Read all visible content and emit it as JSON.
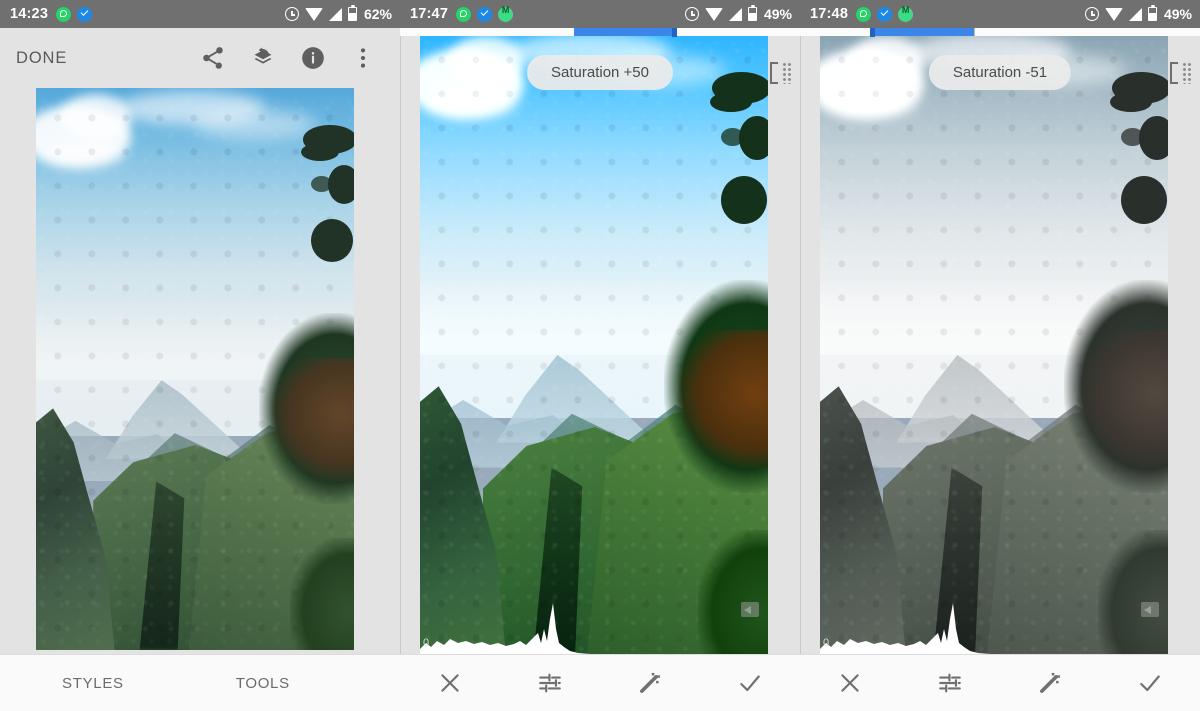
{
  "app": {
    "name": "Snapseed",
    "screenshot_layout": "three-panel"
  },
  "panels": [
    {
      "id": "editor-home",
      "status_bar": {
        "time": "14:23",
        "battery_percent": "62%",
        "left_icons": [
          "whatsapp-icon",
          "blue-check-icon"
        ],
        "right_icons": [
          "alarm-icon",
          "wifi-icon",
          "signal-icon",
          "battery-icon"
        ]
      },
      "toolbar": {
        "done_label": "DONE",
        "icons": [
          "share-icon",
          "revert-stack-icon",
          "info-icon",
          "overflow-menu-icon"
        ]
      },
      "bottom_nav": {
        "styles_label": "STYLES",
        "tools_label": "TOOLS"
      },
      "photo": {
        "alt": "Mountain valley landscape with blue sky, clouds and trees",
        "variant": "original"
      }
    },
    {
      "id": "saturation-increase",
      "status_bar": {
        "time": "17:47",
        "battery_percent": "49%",
        "left_icons": [
          "whatsapp-icon",
          "blue-check-icon",
          "green-m-icon"
        ],
        "right_icons": [
          "alarm-icon",
          "wifi-icon",
          "signal-icon",
          "battery-icon"
        ]
      },
      "chip_label": "Saturation +50",
      "slider": {
        "value": 50,
        "min": -100,
        "max": 100,
        "fill_color": "#3b86e8"
      },
      "histogram_zero_label": "0",
      "bottom_actions": [
        "cancel-icon",
        "tune-icon",
        "auto-adjust-icon",
        "apply-icon"
      ],
      "photo": {
        "alt": "Mountain valley landscape, saturation boosted",
        "variant": "saturation-plus"
      }
    },
    {
      "id": "saturation-decrease",
      "status_bar": {
        "time": "17:48",
        "battery_percent": "49%",
        "left_icons": [
          "whatsapp-icon",
          "blue-check-icon",
          "green-m-icon"
        ],
        "right_icons": [
          "alarm-icon",
          "wifi-icon",
          "signal-icon",
          "battery-icon"
        ]
      },
      "chip_label": "Saturation -51",
      "slider": {
        "value": -51,
        "min": -100,
        "max": 100,
        "fill_color": "#3b86e8"
      },
      "histogram_zero_label": "0",
      "bottom_actions": [
        "cancel-icon",
        "tune-icon",
        "auto-adjust-icon",
        "apply-icon"
      ],
      "photo": {
        "alt": "Mountain valley landscape, saturation reduced to near grayscale",
        "variant": "saturation-minus"
      }
    }
  ],
  "colors": {
    "status_bar_bg": "#707070",
    "toolbar_bg": "#e3e3e3",
    "bottom_bar_bg": "#fafafa",
    "accent_blue": "#3b86e8",
    "text_gray": "#6b6b6b"
  }
}
